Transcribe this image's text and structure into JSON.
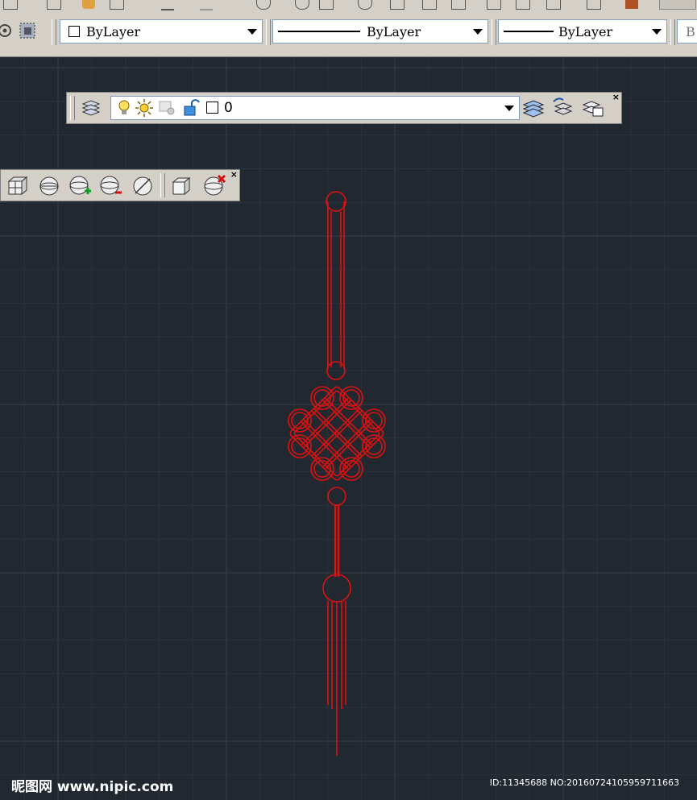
{
  "colors": {
    "canvas_background": "#212830",
    "grid_minor": "#2b333d",
    "grid_major": "#36404b",
    "drawing_stroke": "#e01010",
    "toolbar_bg": "#d4d0c8"
  },
  "properties_toolbar": {
    "color_combo": {
      "value": "ByLayer"
    },
    "linetype_combo": {
      "value": "ByLayer"
    },
    "lineweight_combo": {
      "value": "ByLayer"
    },
    "plotstyle_combo": {
      "value": "B"
    }
  },
  "layers_toolbar": {
    "current_layer": "0",
    "close_label": "×",
    "icons": [
      "layer-properties-manager-icon",
      "layer-on-bulb-icon",
      "freeze-sun-icon",
      "viewport-freeze-icon",
      "unlock-icon",
      "layer-color-swatch-icon",
      "make-object-layer-current-icon",
      "layer-previous-icon",
      "layer-states-icon"
    ]
  },
  "view_toolbar": {
    "close_label": "×",
    "icons": [
      "view-3d-box-icon",
      "sphere-icon",
      "sphere-add-icon",
      "sphere-remove-icon",
      "circle-slash-icon",
      "cube-icon",
      "sphere-delete-icon"
    ]
  },
  "watermark": {
    "site": "昵图网 www.nipic.com",
    "id_text": "ID:11345688 NO:20160724105959711663"
  }
}
